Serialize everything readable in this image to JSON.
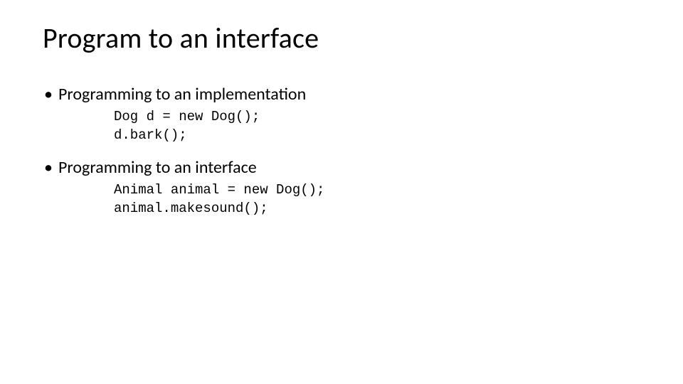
{
  "title": "Program to an interface",
  "sections": [
    {
      "bullet": "Programming to an implementation",
      "code": "Dog d = new Dog();\nd.bark();"
    },
    {
      "bullet": "Programming to an interface",
      "code": "Animal animal = new Dog();\nanimal.makesound();"
    }
  ]
}
